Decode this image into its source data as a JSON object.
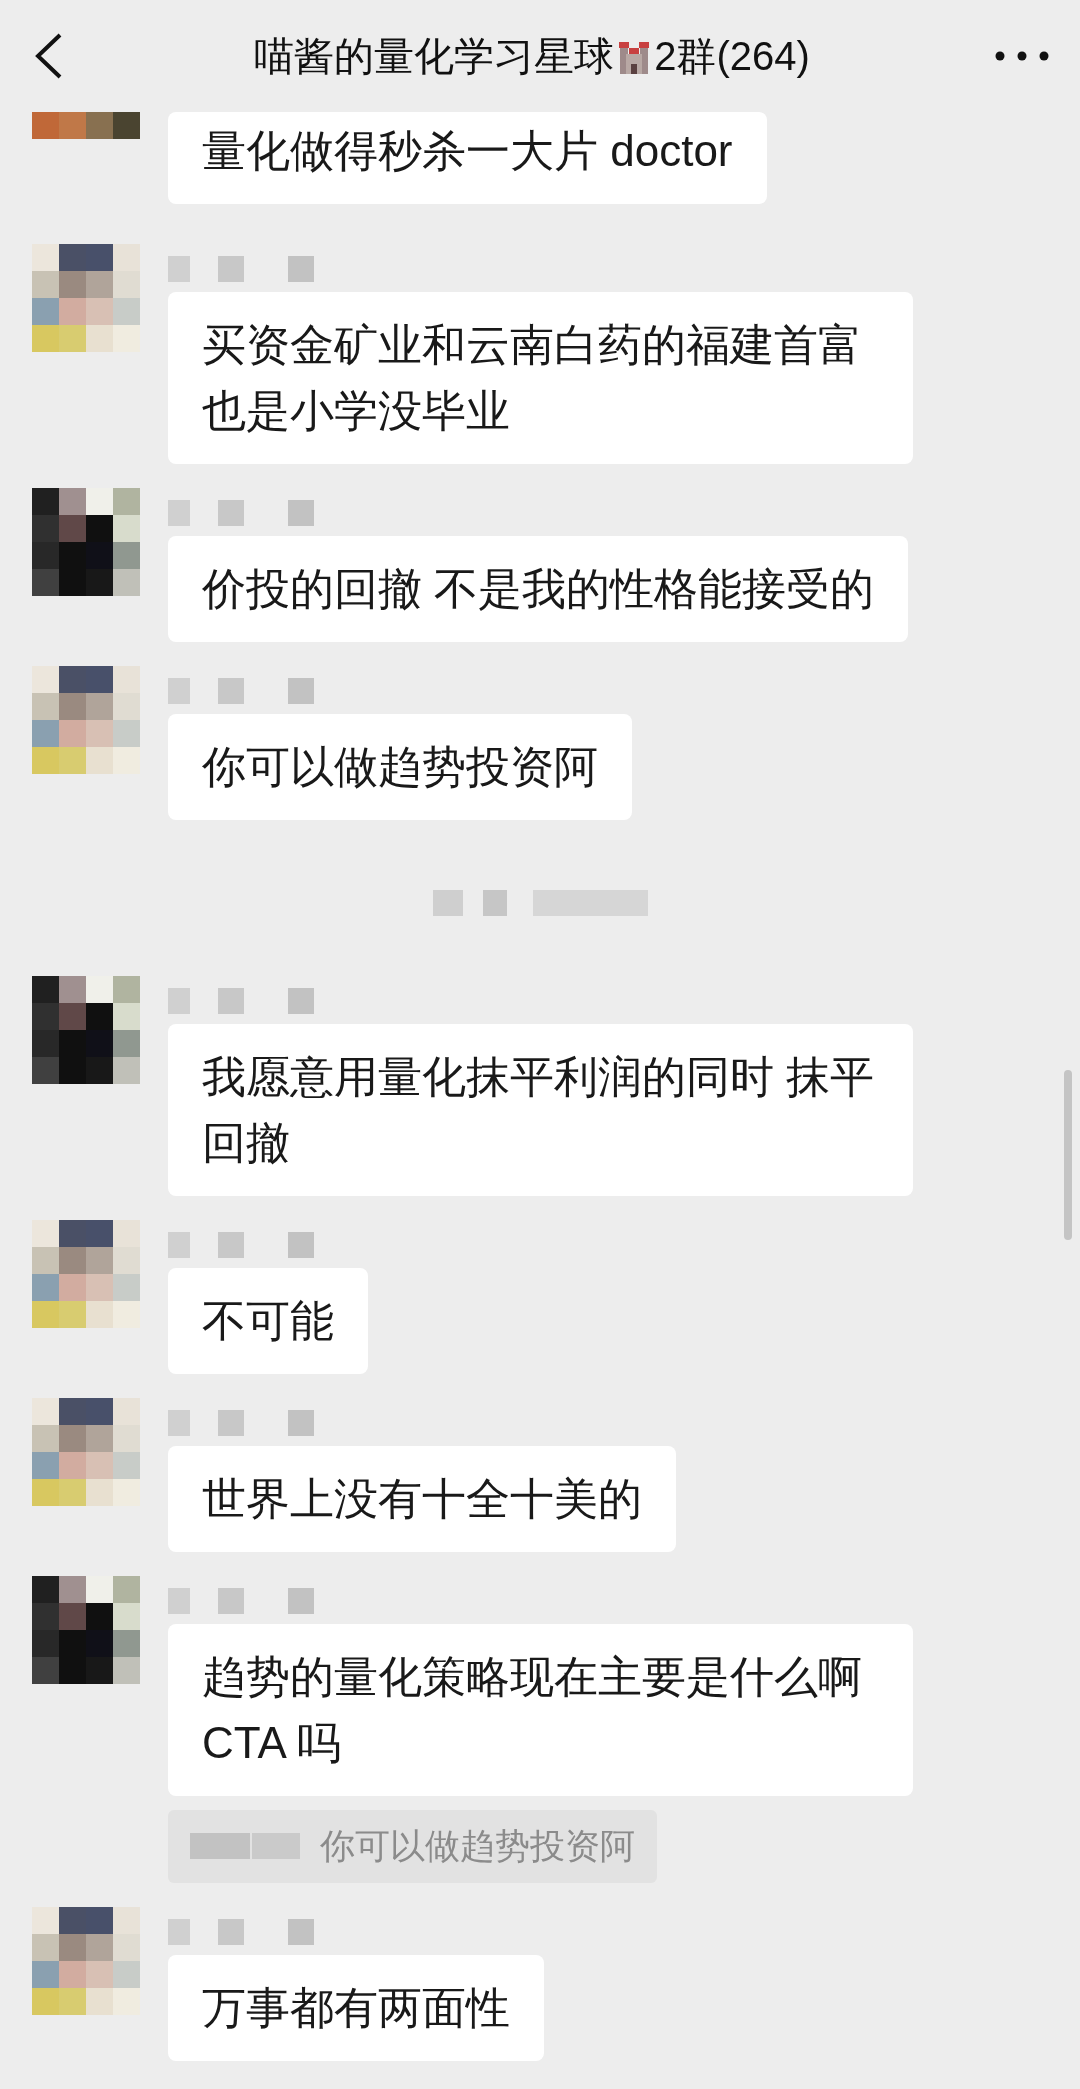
{
  "header": {
    "title": "喵酱的量化学习星球",
    "title_suffix": "2群(264)"
  },
  "messages": [
    {
      "kind": "message",
      "avatar_dark": false,
      "avatar_cropped": true,
      "text": "量化做得秒杀一大片 doctor"
    },
    {
      "kind": "message",
      "avatar_dark": false,
      "avatar_cropped": false,
      "text": "买资金矿业和云南白药的福建首富也是小学没毕业"
    },
    {
      "kind": "message",
      "avatar_dark": true,
      "avatar_cropped": false,
      "text": "价投的回撤 不是我的性格能接受的"
    },
    {
      "kind": "message",
      "avatar_dark": false,
      "avatar_cropped": false,
      "text": "你可以做趋势投资阿"
    },
    {
      "kind": "time-divider"
    },
    {
      "kind": "message",
      "avatar_dark": true,
      "avatar_cropped": false,
      "text": "我愿意用量化抹平利润的同时 抹平回撤"
    },
    {
      "kind": "message",
      "avatar_dark": false,
      "avatar_cropped": false,
      "text": "不可能"
    },
    {
      "kind": "message",
      "avatar_dark": false,
      "avatar_cropped": false,
      "text": "世界上没有十全十美的"
    },
    {
      "kind": "message",
      "avatar_dark": true,
      "avatar_cropped": false,
      "text": "趋势的量化策略现在主要是什么啊 CTA 吗",
      "quote": "你可以做趋势投资阿"
    },
    {
      "kind": "message",
      "avatar_dark": false,
      "avatar_cropped": false,
      "text": "万事都有两面性"
    }
  ]
}
